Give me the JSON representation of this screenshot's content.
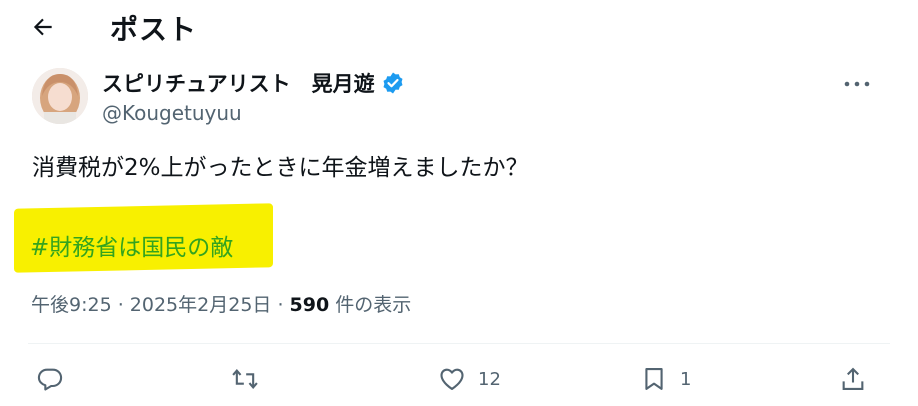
{
  "header": {
    "title": "ポスト",
    "back_icon": "arrow-left-icon"
  },
  "author": {
    "name": "スピリチュアリスト　晃月遊",
    "handle": "@Kougetuyuu",
    "verified_icon": "verified-badge-icon",
    "verified_color": "#1d9bf0"
  },
  "tweet": {
    "text": "消費税が2%上がったときに年金増えましたか？",
    "hashtag": "#財務省は国民の敵",
    "hashtag_color": "#33a41e",
    "highlight_color": "#f8f000"
  },
  "meta": {
    "timestamp": "午後9:25 · 2025年2月25日 · ",
    "views_count": "590",
    "views_label": " 件の表示"
  },
  "actions": {
    "reply_icon": "reply-icon",
    "retweet_icon": "retweet-icon",
    "like_icon": "heart-icon",
    "like_count": "12",
    "bookmark_icon": "bookmark-icon",
    "bookmark_count": "1",
    "share_icon": "share-icon"
  },
  "colors": {
    "text": "#0f1419",
    "secondary": "#536471"
  }
}
